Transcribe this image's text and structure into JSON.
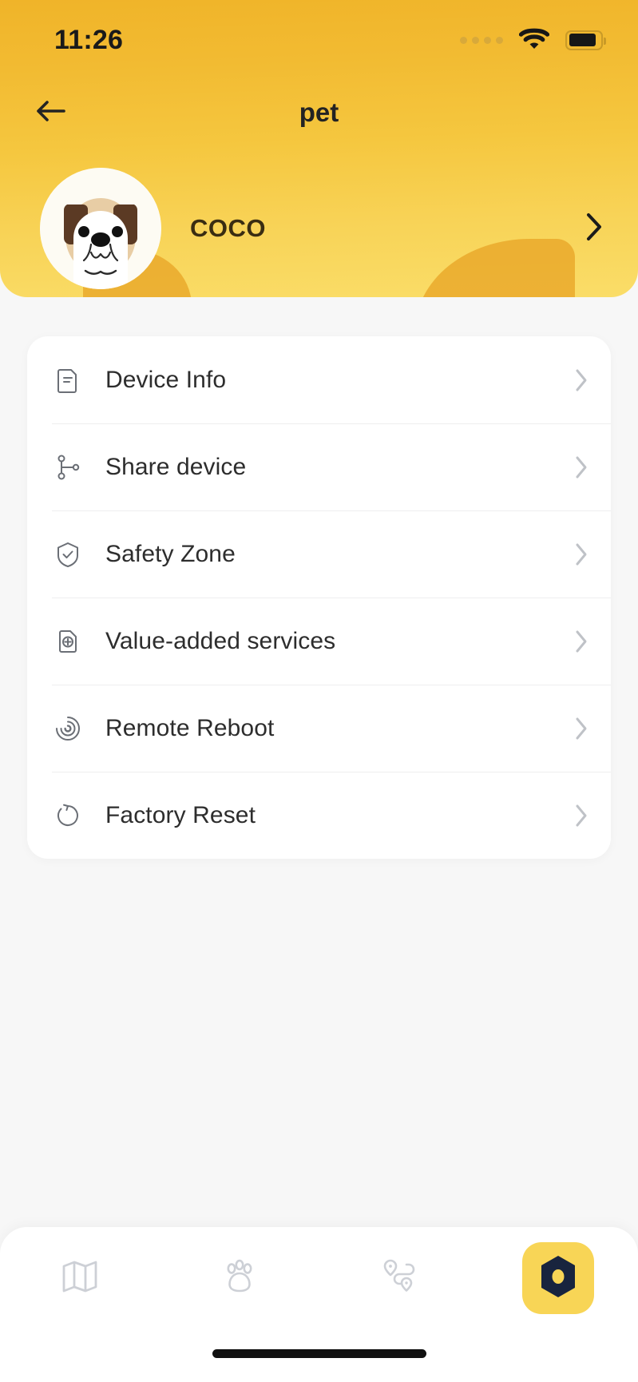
{
  "status_bar": {
    "time": "11:26",
    "signal_icon": "signal-dots-icon",
    "wifi_icon": "wifi-icon",
    "battery_icon": "battery-icon"
  },
  "header": {
    "title": "pet",
    "back_icon": "back-arrow-icon",
    "accent_color": "#f5c73f",
    "gradient_top": "#f0b429",
    "gradient_bottom": "#fadd68",
    "decoration_color": "#eaa92b"
  },
  "pet": {
    "name": "COCO",
    "avatar_icon": "dog-avatar-icon",
    "chevron_icon": "chevron-right-icon",
    "avatar_colors": {
      "circle": "#fdfbf3",
      "face": "#e8cda5",
      "ear": "#5b3a24",
      "muzzle": "#ffffff",
      "eye": "#111111"
    }
  },
  "menu": {
    "items": [
      {
        "label": "Device Info",
        "icon": "document-info-icon",
        "chevron": "chevron-right-icon"
      },
      {
        "label": "Share device",
        "icon": "share-nodes-icon",
        "chevron": "chevron-right-icon"
      },
      {
        "label": "Safety Zone",
        "icon": "shield-check-icon",
        "chevron": "chevron-right-icon"
      },
      {
        "label": "Value-added services",
        "icon": "sim-plus-icon",
        "chevron": "chevron-right-icon"
      },
      {
        "label": "Remote Reboot",
        "icon": "signal-spiral-icon",
        "chevron": "chevron-right-icon"
      },
      {
        "label": "Factory Reset",
        "icon": "refresh-reset-icon",
        "chevron": "chevron-right-icon"
      }
    ]
  },
  "bottom_nav": {
    "items": [
      {
        "icon": "map-icon",
        "active": false
      },
      {
        "icon": "paw-icon",
        "active": false
      },
      {
        "icon": "route-icon",
        "active": false
      },
      {
        "icon": "device-hex-icon",
        "active": true
      }
    ],
    "active_pill_color": "#f8d556",
    "active_icon_color": "#18243e",
    "inactive_icon_color": "#cdd0d6",
    "home_indicator": "home-indicator"
  }
}
